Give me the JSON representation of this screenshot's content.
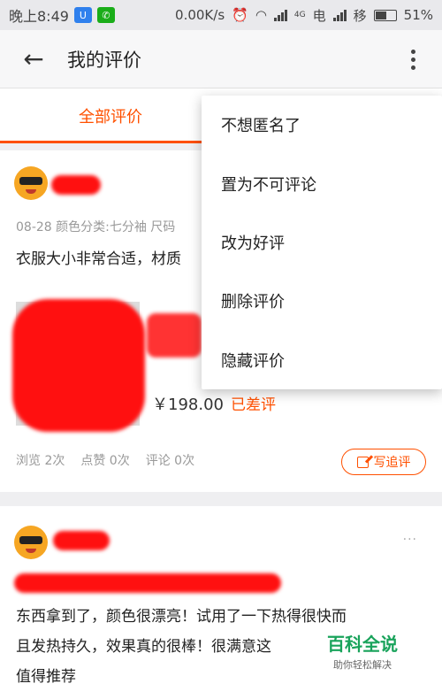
{
  "status_bar": {
    "time": "晚上8:49",
    "network_speed": "0.00K/s",
    "carrier1": "电",
    "carrier2": "移",
    "battery": "51%",
    "net_type": "4G"
  },
  "app_bar": {
    "title": "我的评价"
  },
  "tabs": [
    {
      "label": "全部评价",
      "active": true
    }
  ],
  "review1": {
    "meta": "08-28  颜色分类:七分袖 尺码",
    "content": "衣服大小非常合适，材质",
    "price": "￥198.00",
    "status": "已差评",
    "stats": {
      "views": "浏览 2次",
      "likes": "点赞 0次",
      "comments": "评论 0次"
    },
    "followup_label": "写追评"
  },
  "review2": {
    "more_glyph": "···",
    "content_line1": "东西拿到了，颜色很漂亮！试用了一下热得很快而",
    "content_line2": "且发热持久，效果真的很棒！很满意这",
    "content_line3": "值得推荐"
  },
  "menu": {
    "items": [
      "不想匿名了",
      "置为不可评论",
      "改为好评",
      "删除评价",
      "隐藏评价"
    ]
  },
  "watermark": {
    "logo": "百科全说",
    "sub": "助你轻松解决"
  },
  "colors": {
    "accent": "#ff5000",
    "redaction": "#ff1010",
    "watermark": "#19a35b"
  }
}
